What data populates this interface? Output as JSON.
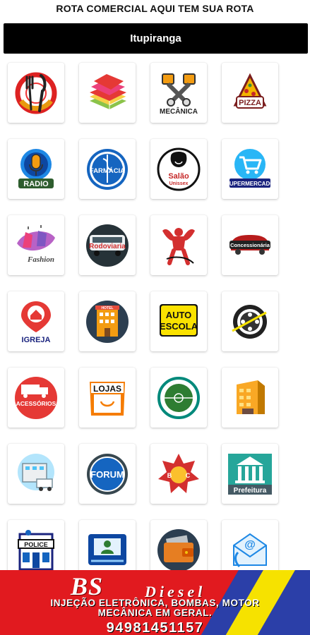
{
  "header": {
    "title": "ROTA COMERCIAL AQUI TEM SUA ROTA"
  },
  "city_selector": {
    "label": "Itupiranga"
  },
  "grid": {
    "row1": {
      "food": "",
      "books": "",
      "mecanica": "MECÂNICA",
      "pizza": "PIZZA"
    },
    "row2": {
      "radio": "RADIO",
      "farmacia": "FARMÁCIA",
      "salao": "Salão",
      "salao_sub": "Unissex",
      "supermercado": "SUPERMERCADO"
    },
    "row3": {
      "fashion": "Fashion",
      "rodoviaria": "Rodoviaria",
      "gym": "",
      "concessionaria": "Concessionária"
    },
    "row4": {
      "igreja": "IGREJA",
      "hotel": "HOTEL",
      "autoescola_1": "AUTO",
      "autoescola_2": "ESCOLA",
      "cinema": ""
    },
    "row5": {
      "acessorios": "ACESSÓRIOS",
      "lojas": "LOJAS",
      "stadium": "",
      "building": ""
    },
    "row6": {
      "hospital": "",
      "forum": "FORUM",
      "bombeiros_b": "B",
      "bombeiros_c": "C",
      "prefeitura": "Prefeitura"
    },
    "row7": {
      "police": "POLICE",
      "bank": "",
      "wallet": "",
      "email": "@"
    }
  },
  "banner": {
    "brand": "BS",
    "brand_sub": "Diesel",
    "services_line1": "INJEÇÃO ELETRÔNICA, BOMBAS, MOTOR",
    "services_line2": "MECÂNICA EM GERAL.",
    "phone": "94981451157"
  },
  "colors": {
    "header_bar": "#000000",
    "banner_red": "#e11a1f",
    "banner_blue": "#2b3fa8",
    "banner_yellow": "#f6e200"
  }
}
